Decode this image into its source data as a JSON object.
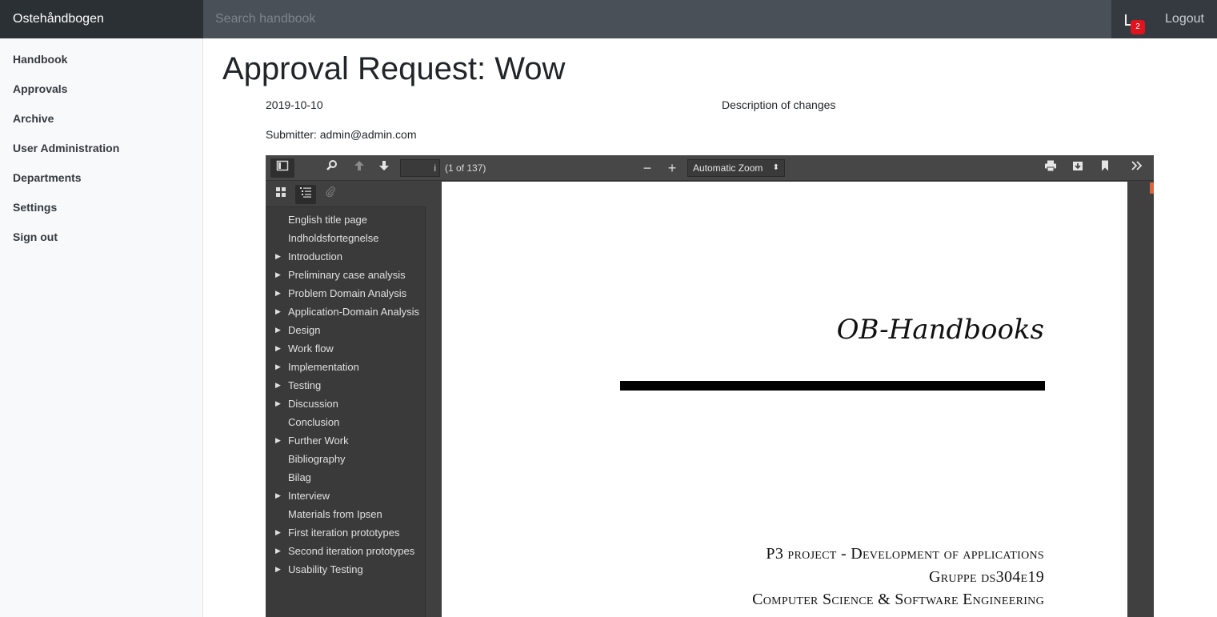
{
  "app": {
    "brand": "Ostehåndbogen",
    "search_placeholder": "Search handbook",
    "notification_count": "2",
    "logout": "Logout"
  },
  "sidebar": {
    "items": [
      {
        "label": "Handbook"
      },
      {
        "label": "Approvals"
      },
      {
        "label": "Archive"
      },
      {
        "label": "User Administration"
      },
      {
        "label": "Departments"
      },
      {
        "label": "Settings"
      },
      {
        "label": "Sign out"
      }
    ]
  },
  "request": {
    "title": "Approval Request: Wow",
    "date": "2019-10-10",
    "description_label": "Description of changes",
    "submitter": "Submitter: admin@admin.com"
  },
  "pdf": {
    "page_input": "i",
    "page_count": "(1 of 137)",
    "zoom": "Automatic Zoom",
    "outline": [
      {
        "label": "English title page",
        "expandable": false
      },
      {
        "label": "Indholdsfortegnelse",
        "expandable": false
      },
      {
        "label": "Introduction",
        "expandable": true
      },
      {
        "label": "Preliminary case analysis",
        "expandable": true
      },
      {
        "label": "Problem Domain Analysis",
        "expandable": true
      },
      {
        "label": "Application-Domain Analysis",
        "expandable": true
      },
      {
        "label": "Design",
        "expandable": true
      },
      {
        "label": "Work flow",
        "expandable": true
      },
      {
        "label": "Implementation",
        "expandable": true
      },
      {
        "label": "Testing",
        "expandable": true
      },
      {
        "label": "Discussion",
        "expandable": true
      },
      {
        "label": "Conclusion",
        "expandable": false
      },
      {
        "label": "Further Work",
        "expandable": true
      },
      {
        "label": "Bibliography",
        "expandable": false
      },
      {
        "label": "Bilag",
        "expandable": false
      },
      {
        "label": "Interview",
        "expandable": true
      },
      {
        "label": "Materials from Ipsen",
        "expandable": false
      },
      {
        "label": "First iteration prototypes",
        "expandable": true
      },
      {
        "label": "Second iteration prototypes",
        "expandable": true
      },
      {
        "label": "Usability Testing",
        "expandable": true
      }
    ],
    "page": {
      "title": "OB-Handbooks",
      "lines": [
        "P3 project - Development of applications",
        "Gruppe ds304e19",
        "Computer Science & Software Engineering"
      ]
    }
  }
}
